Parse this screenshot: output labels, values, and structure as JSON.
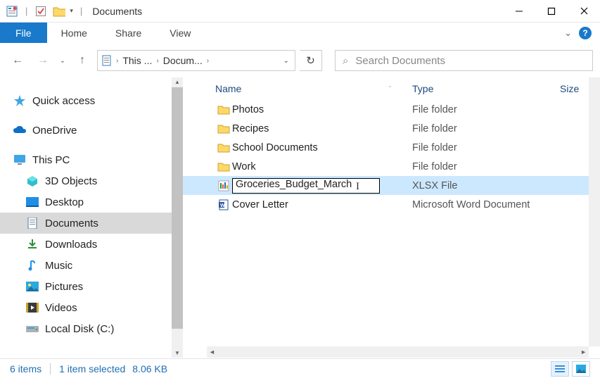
{
  "titlebar": {
    "title": "Documents"
  },
  "ribbon": {
    "file": "File",
    "tabs": [
      "Home",
      "Share",
      "View"
    ]
  },
  "address": {
    "crumbs": [
      "This ...",
      "Docum..."
    ],
    "refresh_glyph": "↻"
  },
  "search": {
    "placeholder": "Search Documents"
  },
  "nav": {
    "quick_access": "Quick access",
    "onedrive": "OneDrive",
    "this_pc": "This PC",
    "items": [
      {
        "label": "3D Objects"
      },
      {
        "label": "Desktop"
      },
      {
        "label": "Documents"
      },
      {
        "label": "Downloads"
      },
      {
        "label": "Music"
      },
      {
        "label": "Pictures"
      },
      {
        "label": "Videos"
      },
      {
        "label": "Local Disk (C:)"
      }
    ]
  },
  "columns": {
    "name": "Name",
    "type": "Type",
    "size": "Size"
  },
  "files": [
    {
      "name": "Photos",
      "type": "File folder",
      "kind": "folder"
    },
    {
      "name": "Recipes",
      "type": "File folder",
      "kind": "folder"
    },
    {
      "name": "School Documents",
      "type": "File folder",
      "kind": "folder"
    },
    {
      "name": "Work",
      "type": "File folder",
      "kind": "folder"
    },
    {
      "name": "Groceries_Budget_March",
      "type": "XLSX File",
      "kind": "xlsx",
      "selected": true,
      "renaming": true
    },
    {
      "name": "Cover Letter",
      "type": "Microsoft Word Document",
      "kind": "docx"
    }
  ],
  "status": {
    "count": "6 items",
    "selection": "1 item selected",
    "size": "8.06 KB"
  }
}
